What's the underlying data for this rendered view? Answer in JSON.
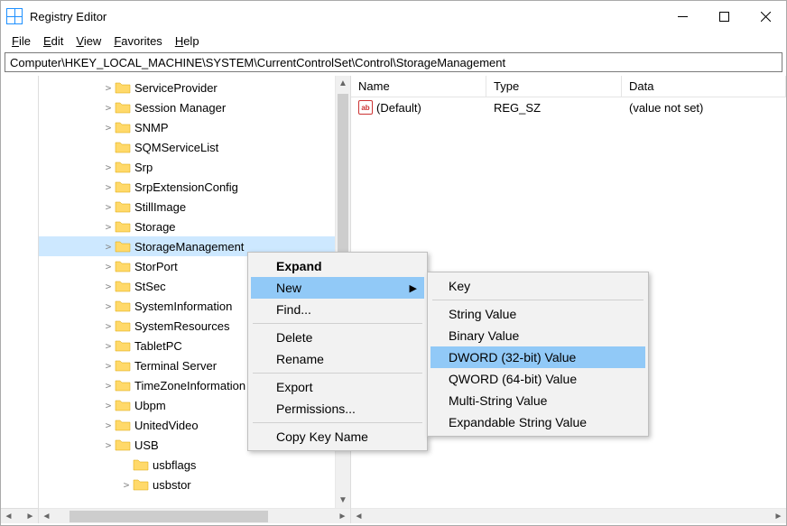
{
  "window": {
    "title": "Registry Editor"
  },
  "menubar": {
    "file": "File",
    "edit": "Edit",
    "view": "View",
    "favorites": "Favorites",
    "help": "Help"
  },
  "addressbar": {
    "path": "Computer\\HKEY_LOCAL_MACHINE\\SYSTEM\\CurrentControlSet\\Control\\StorageManagement"
  },
  "tree": {
    "items": [
      {
        "label": "ServiceProvider",
        "expandable": true
      },
      {
        "label": "Session Manager",
        "expandable": true
      },
      {
        "label": "SNMP",
        "expandable": true
      },
      {
        "label": "SQMServiceList",
        "expandable": false
      },
      {
        "label": "Srp",
        "expandable": true
      },
      {
        "label": "SrpExtensionConfig",
        "expandable": true
      },
      {
        "label": "StillImage",
        "expandable": true
      },
      {
        "label": "Storage",
        "expandable": true
      },
      {
        "label": "StorageManagement",
        "expandable": true,
        "selected": true
      },
      {
        "label": "StorPort",
        "expandable": true
      },
      {
        "label": "StSec",
        "expandable": true
      },
      {
        "label": "SystemInformation",
        "expandable": true
      },
      {
        "label": "SystemResources",
        "expandable": true
      },
      {
        "label": "TabletPC",
        "expandable": true
      },
      {
        "label": "Terminal Server",
        "expandable": true
      },
      {
        "label": "TimeZoneInformation",
        "expandable": true
      },
      {
        "label": "Ubpm",
        "expandable": true
      },
      {
        "label": "UnitedVideo",
        "expandable": true
      },
      {
        "label": "USB",
        "expandable": true
      },
      {
        "label": "usbflags",
        "expandable": false,
        "indent": true
      },
      {
        "label": "usbstor",
        "expandable": true,
        "indent": true
      }
    ]
  },
  "values": {
    "headers": {
      "name": "Name",
      "type": "Type",
      "data": "Data"
    },
    "rows": [
      {
        "icon": "ab",
        "name": "(Default)",
        "type": "REG_SZ",
        "data": "(value not set)"
      }
    ]
  },
  "context_main": {
    "expand": "Expand",
    "new": "New",
    "find": "Find...",
    "delete": "Delete",
    "rename": "Rename",
    "export": "Export",
    "permissions": "Permissions...",
    "copy_key_name": "Copy Key Name"
  },
  "context_sub": {
    "key": "Key",
    "string": "String Value",
    "binary": "Binary Value",
    "dword": "DWORD (32-bit) Value",
    "qword": "QWORD (64-bit) Value",
    "multi": "Multi-String Value",
    "expand_str": "Expandable String Value"
  }
}
